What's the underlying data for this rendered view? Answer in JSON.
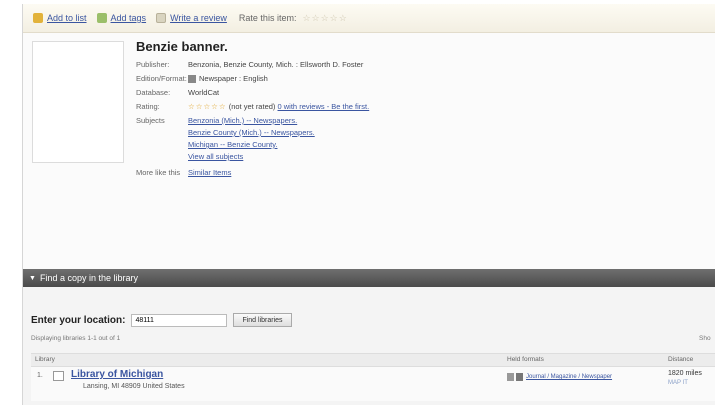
{
  "toolbar": {
    "add_to_list": "Add to list",
    "add_tags": "Add tags",
    "write_review": "Write a review",
    "rate_label": "Rate this item:",
    "rate_stars": "☆☆☆☆☆"
  },
  "record": {
    "title": "Benzie banner.",
    "details": {
      "publisher_label": "Publisher:",
      "publisher_value": "Benzonia, Benzie County, Mich. : Ellsworth D. Foster",
      "format_label": "Edition/Format:",
      "format_value": "Newspaper : English",
      "database_label": "Database:",
      "database_value": "WorldCat",
      "rating_label": "Rating:",
      "rating_stars": "☆☆☆☆☆",
      "rating_note": "(not yet rated)",
      "rating_link": "0 with reviews - Be the first.",
      "subjects_label": "Subjects",
      "subjects": [
        "Benzonia (Mich.) -- Newspapers.",
        "Benzie County (Mich.) -- Newspapers.",
        "Michigan -- Benzie County.",
        "View all subjects"
      ],
      "more_label": "More like this",
      "more_link": "Similar Items"
    }
  },
  "find_copy": {
    "header": "Find a copy in the library",
    "location_label": "Enter your location:",
    "location_value": "48111",
    "find_button": "Find libraries",
    "displaying": "Displaying libraries 1-1 out of 1",
    "display_right": "Sho",
    "columns": [
      "Library",
      "Held formats",
      "Distance"
    ],
    "libraries": [
      {
        "number": "1.",
        "name": "Library of Michigan",
        "address": "Lansing, MI 48909 United States",
        "held": "Journal / Magazine / Newspaper",
        "distance": "1820 miles",
        "map": "MAP IT"
      }
    ]
  }
}
